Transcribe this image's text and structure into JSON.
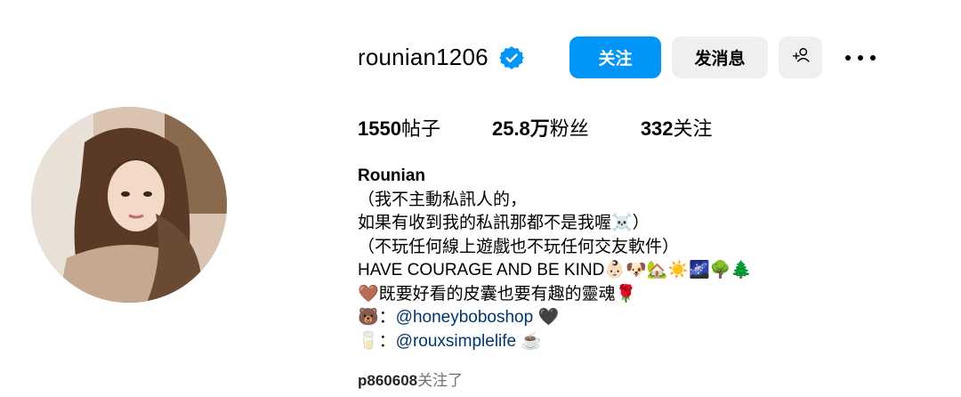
{
  "profile": {
    "username": "rounian1206",
    "verified_icon": "verified-badge-icon",
    "accent_color": "#0095f6"
  },
  "actions": {
    "follow_label": "关注",
    "message_label": "发消息",
    "add_user_icon": "add-user-icon",
    "more_icon": "more-options-icon"
  },
  "stats": {
    "posts_count": "1550",
    "posts_label": "帖子",
    "followers_count": "25.8万",
    "followers_label": "粉丝",
    "following_count": "332",
    "following_label": "关注"
  },
  "bio": {
    "display_name": "Rounian",
    "lines": [
      "（我不主動私訊人的，",
      "如果有收到我的私訊那都不是我喔☠️）",
      "（不玩任何線上遊戲也不玩任何交友軟件）",
      "HAVE COURAGE AND BE KIND👶🏻🐶🏡☀️🌌🌳🌲",
      "🤎既要好看的皮囊也要有趣的靈魂🌹"
    ],
    "shop_prefix": "🐻：",
    "shop_link": "@honeyboboshop",
    "shop_suffix": "🖤",
    "life_prefix": "🥛：",
    "life_link": "@rouxsimplelife",
    "life_suffix": "☕️"
  },
  "followed_by": {
    "user": "p860608",
    "text": "关注了"
  }
}
